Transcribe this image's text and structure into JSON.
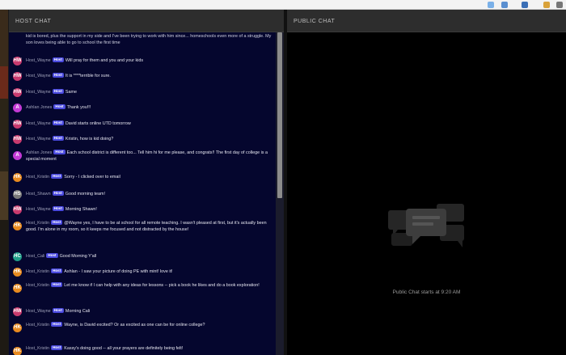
{
  "host_chat": {
    "title": "HOST CHAT",
    "messages": [
      {
        "kind": "text",
        "text": "kid is bored, plus the support in my side and I've been trying to work with him since... homeschools even more of a struggle. My son loves being able to go to school the first time"
      },
      {
        "kind": "msg",
        "user": "Host_Wayne",
        "badge": "Host",
        "text": "Will pray for them and you and your kids",
        "avatar": "#c93a6e",
        "initials": "HW"
      },
      {
        "kind": "msg",
        "user": "Host_Wayne",
        "badge": "Host",
        "text": "It is ****terrible for sure.",
        "avatar": "#c93a6e",
        "initials": "HW"
      },
      {
        "kind": "msg",
        "user": "Host_Wayne",
        "badge": "Host",
        "text": "Same",
        "avatar": "#c93a6e",
        "initials": "HW"
      },
      {
        "kind": "msg",
        "user": "Ashlan Jones",
        "badge": "Host",
        "text": "Thank you!!!",
        "avatar": "#c43ad6",
        "initials": "A"
      },
      {
        "kind": "msg",
        "user": "Host_Wayne",
        "badge": "Host",
        "text": "David starts online UTD tomorrow",
        "avatar": "#c93a6e",
        "initials": "HW"
      },
      {
        "kind": "msg",
        "user": "Host_Wayne",
        "badge": "Host",
        "text": "Kristin, how is kid doing?",
        "avatar": "#c93a6e",
        "initials": "HW"
      },
      {
        "kind": "msg",
        "user": "Ashlan Jones",
        "badge": "Host",
        "text": "Each school district is different too... Tell him hi for me please, and congrats!! The first day of college is a special moment",
        "avatar": "#c43ad6",
        "initials": "A"
      },
      {
        "kind": "msg",
        "user": "Host_Kristin",
        "badge": "Host",
        "text": "Sorry - I clicked over to email",
        "avatar": "#e88a1f",
        "initials": "HK"
      },
      {
        "kind": "msg",
        "user": "Host_Shawn",
        "badge": "Host",
        "text": "Good morning team!",
        "avatar": "#7a7a7a",
        "initials": "HS"
      },
      {
        "kind": "msg",
        "user": "Host_Wayne",
        "badge": "Host",
        "text": "Morning Shawn!",
        "avatar": "#c93a6e",
        "initials": "HW"
      },
      {
        "kind": "msg",
        "user": "Host_Kristin",
        "badge": "Host",
        "text": "@Wayne yes, I have to be at school for all remote teaching. I wasn't pleased at first, but it's actually been good. I'm alone in my room, so it keeps me focused and not distracted by the house!",
        "avatar": "#e88a1f",
        "initials": "HK"
      },
      {
        "kind": "msg",
        "user": "Host_Cali",
        "badge": "Host",
        "text": "Good Morning Y'all",
        "avatar": "#1f9e88",
        "initials": "HC"
      },
      {
        "kind": "msg",
        "user": "Host_Kristin",
        "badge": "Host",
        "text": "Ashlan - I saw your picture of doing PE with mint! love it!",
        "avatar": "#e88a1f",
        "initials": "HK"
      },
      {
        "kind": "msg",
        "user": "Host_Kristin",
        "badge": "Host",
        "text": "Let me know if I can help with any ideas for lessons -- pick a book he likes and do a book exploration!",
        "avatar": "#e88a1f",
        "initials": "HK"
      },
      {
        "kind": "msg",
        "user": "Host_Wayne",
        "badge": "Host",
        "text": "Morning Cali",
        "avatar": "#c93a6e",
        "initials": "HW"
      },
      {
        "kind": "msg",
        "user": "Host_Kristin",
        "badge": "Host",
        "text": "Wayne, is David excited? Or as excited as one can be for online college?",
        "avatar": "#e88a1f",
        "initials": "HK"
      },
      {
        "kind": "msg",
        "user": "Host_Kristin",
        "badge": "Host",
        "text": "Kassy's doing good -- all your prayers are definitely being felt!",
        "avatar": "#e88a1f",
        "initials": "HK"
      }
    ]
  },
  "public_chat": {
    "title": "PUBLIC CHAT",
    "empty_note": "Public Chat starts at 9:20 AM",
    "icon": "chat-bubbles-icon"
  }
}
